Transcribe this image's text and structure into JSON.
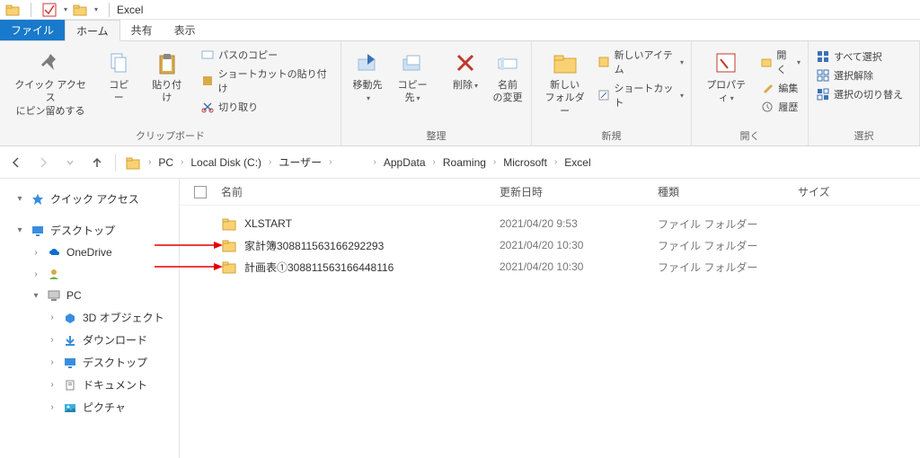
{
  "title": "Excel",
  "tabs": {
    "file": "ファイル",
    "home": "ホーム",
    "share": "共有",
    "view": "表示"
  },
  "ribbon": {
    "pin": {
      "line1": "クイック アクセス",
      "line2": "にピン留めする"
    },
    "copy": "コピー",
    "paste": "貼り付け",
    "path_copy": "パスのコピー",
    "paste_shortcut": "ショートカットの貼り付け",
    "cut": "切り取り",
    "group_clipboard": "クリップボード",
    "move_to": "移動先",
    "copy_to": "コピー先",
    "delete": "削除",
    "rename": {
      "line1": "名前",
      "line2": "の変更"
    },
    "group_organize": "整理",
    "new_folder": {
      "line1": "新しい",
      "line2": "フォルダー"
    },
    "new_item": "新しいアイテム",
    "shortcut": "ショートカット",
    "group_new": "新規",
    "properties": "プロパティ",
    "open": "開く",
    "edit": "編集",
    "history": "履歴",
    "group_open": "開く",
    "select_all": "すべて選択",
    "select_none": "選択解除",
    "select_invert": "選択の切り替え",
    "group_select": "選択"
  },
  "breadcrumbs": [
    "PC",
    "Local Disk (C:)",
    "ユーザー",
    "",
    "AppData",
    "Roaming",
    "Microsoft",
    "Excel"
  ],
  "nav": {
    "quick_access": "クイック アクセス",
    "desktop": "デスクトップ",
    "onedrive": "OneDrive",
    "user": "",
    "pc": "PC",
    "objects3d": "3D オブジェクト",
    "downloads": "ダウンロード",
    "desktop2": "デスクトップ",
    "documents": "ドキュメント",
    "pictures": "ピクチャ"
  },
  "columns": {
    "name": "名前",
    "date": "更新日時",
    "type": "種類",
    "size": "サイズ"
  },
  "rows": [
    {
      "name": "XLSTART",
      "date": "2021/04/20 9:53",
      "type": "ファイル フォルダー",
      "highlight": false
    },
    {
      "name": "家計簿308811563166292293",
      "date": "2021/04/20 10:30",
      "type": "ファイル フォルダー",
      "highlight": true
    },
    {
      "name": "計画表①308811563166448116",
      "date": "2021/04/20 10:30",
      "type": "ファイル フォルダー",
      "highlight": true
    }
  ]
}
